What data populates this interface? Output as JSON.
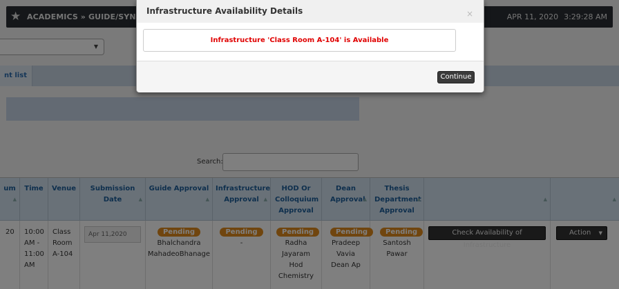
{
  "header": {
    "breadcrumb": "ACADEMICS » GUIDE/SYNOPSIS",
    "date": "APR 11, 2020",
    "time": "3:29:28 AM",
    "icon": "star-icon"
  },
  "tab": {
    "label": "nt list"
  },
  "search": {
    "label": "Search:",
    "placeholder": ""
  },
  "table": {
    "headers": [
      "um",
      "Time",
      "Venue",
      "Submission Date",
      "Guide Approval",
      "Infrastructure Approval",
      "HOD Or Colloquium Approval",
      "Dean Approval",
      "Thesis Department Approval",
      "",
      ""
    ],
    "row": {
      "num": "20",
      "time": "10:00 AM - 11:00 AM",
      "venue": "Class Room A-104",
      "submission_date": "Apr 11,2020",
      "guide_status": "Pending",
      "guide_name": "Bhalchandra MahadeoBhanage",
      "infra_status": "Pending",
      "infra_name": "-",
      "hod_status": "Pending",
      "hod_name": "Radha Jayaram Hod Chemistry",
      "dean_status": "Pending",
      "dean_name": "Pradeep Vavia Dean Ap",
      "thesis_status": "Pending",
      "thesis_name": "Santosh Pawar",
      "check_button": "Check Availability of Infrastructure",
      "action_button": "Action"
    }
  },
  "modal": {
    "title": "Infrastructure Availability Details",
    "close": "×",
    "message": "Infrastructure 'Class Room A-104' is Available",
    "continue_label": "Continue"
  },
  "colors": {
    "overlay": "#000000",
    "message": "#e00000",
    "badge": "#e08b1c"
  }
}
